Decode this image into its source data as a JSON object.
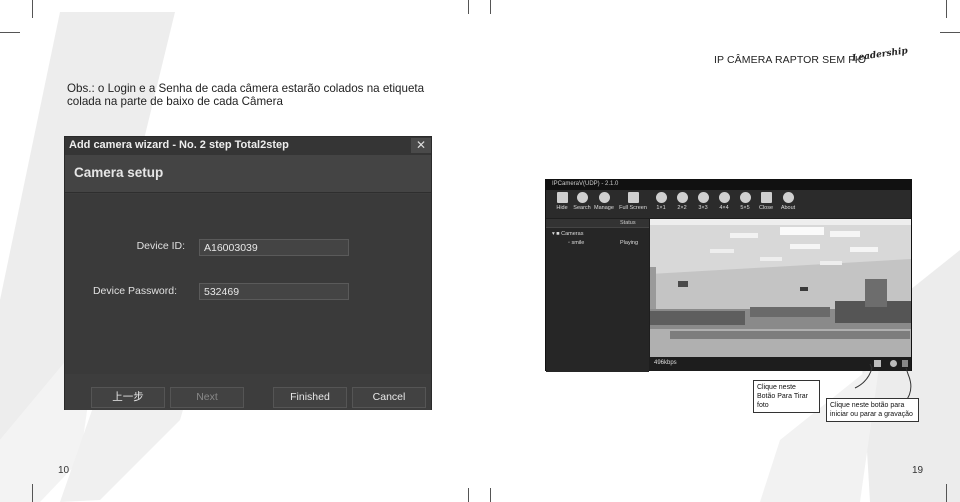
{
  "header": {
    "title": "IP CÂMERA RAPTOR SEM FIO",
    "logo_text": "Leadership"
  },
  "note": {
    "text": "Obs.: o Login e a Senha de cada câmera estarão colados na etiqueta colada na parte de baixo de cada Câmera"
  },
  "wizard": {
    "window_title": "Add camera wizard - No. 2 step Total2step",
    "close_glyph": "✕",
    "section_title": "Camera setup",
    "device_id_label": "Device ID:",
    "device_id_value": "A16003039",
    "password_label": "Device Password:",
    "password_value": "532469",
    "buttons": {
      "prev": "上一步",
      "next": "Next",
      "finished": "Finished",
      "cancel": "Cancel"
    }
  },
  "camera_app": {
    "window_title": "IPCameraV(UDP) - 2.1.0",
    "toolbar": [
      {
        "label": "Hide",
        "icon": "hide-icon"
      },
      {
        "label": "Search",
        "icon": "search-icon"
      },
      {
        "label": "Manage",
        "icon": "gear-icon"
      },
      {
        "label": "Full Screen",
        "icon": "fullscreen-icon"
      },
      {
        "label": "1×1",
        "icon": "grid-icon"
      },
      {
        "label": "2×2",
        "icon": "grid-icon"
      },
      {
        "label": "3×3",
        "icon": "grid-icon"
      },
      {
        "label": "4×4",
        "icon": "grid-icon"
      },
      {
        "label": "5×5",
        "icon": "grid-icon"
      },
      {
        "label": "Close",
        "icon": "close-icon"
      },
      {
        "label": "About",
        "icon": "info-icon"
      }
    ],
    "tree_status_header": "Status",
    "tree_root": "Cameras",
    "tree_camera_name": "smile",
    "tree_camera_status": "Playing",
    "bitrate": "496kbps"
  },
  "callouts": {
    "photo": "Clique neste Botão Para Tirar foto",
    "record": "Clique neste botão para iniciar ou parar a gravação"
  },
  "page_numbers": {
    "left": "10",
    "right": "19"
  }
}
